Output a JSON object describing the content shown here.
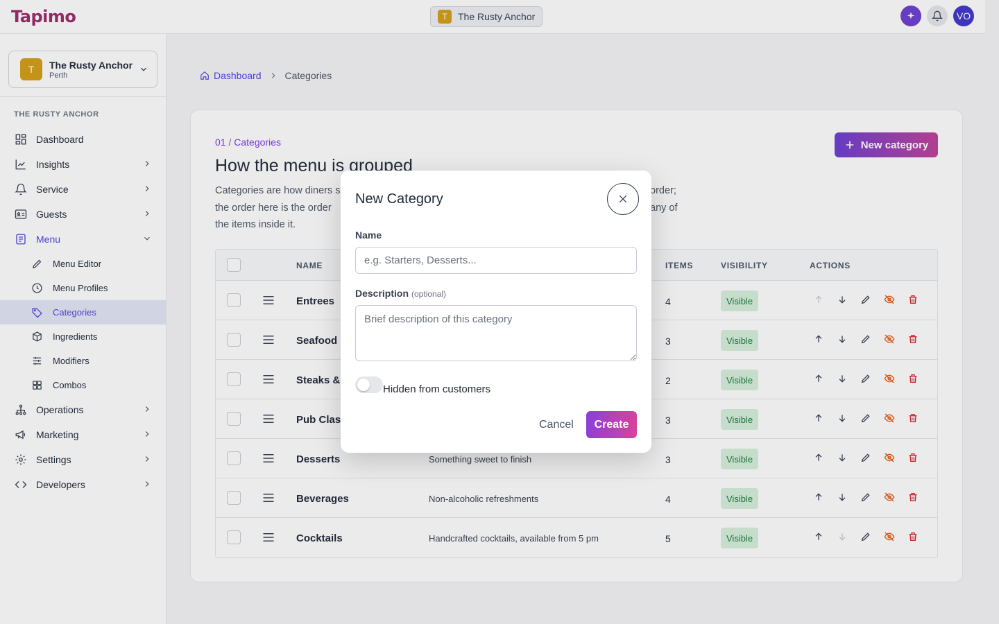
{
  "app": {
    "logo": "Tapimo",
    "venue_pill": {
      "initial": "T",
      "name": "The Rusty Anchor"
    },
    "avatar_initials": "VO"
  },
  "sidebar": {
    "venue": {
      "initial": "T",
      "name": "The Rusty Anchor",
      "city": "Perth"
    },
    "section": "THE RUSTY ANCHOR",
    "items": [
      {
        "label": "Dashboard",
        "icon": "dashboard-grid-icon",
        "chevron": false
      },
      {
        "label": "Insights",
        "icon": "chart-line-icon",
        "chevron": true
      },
      {
        "label": "Service",
        "icon": "bell-icon",
        "chevron": true
      },
      {
        "label": "Guests",
        "icon": "id-card-icon",
        "chevron": true
      },
      {
        "label": "Menu",
        "icon": "menu-doc-icon",
        "chevron": true,
        "expanded": true
      }
    ],
    "menu_sub": [
      {
        "label": "Menu Editor",
        "icon": "pencil-icon"
      },
      {
        "label": "Menu Profiles",
        "icon": "clock-icon"
      },
      {
        "label": "Categories",
        "icon": "tag-icon",
        "active": true
      },
      {
        "label": "Ingredients",
        "icon": "box-icon"
      },
      {
        "label": "Modifiers",
        "icon": "sliders-icon"
      },
      {
        "label": "Combos",
        "icon": "grid-icon"
      }
    ],
    "items_after": [
      {
        "label": "Operations",
        "icon": "sitemap-icon"
      },
      {
        "label": "Marketing",
        "icon": "megaphone-icon"
      },
      {
        "label": "Settings",
        "icon": "gear-icon"
      },
      {
        "label": "Developers",
        "icon": "code-icon"
      }
    ]
  },
  "breadcrumb": {
    "home": "Dashboard",
    "current": "Categories"
  },
  "page": {
    "step_num": "01",
    "step_label": "Categories",
    "title": "How the menu is grouped",
    "desc_line1": "Categories are how diners s",
    "desc_line1_end": "order;",
    "desc_line2": "the order here is the order",
    "desc_line2_end": "any of",
    "desc_line3": "the items inside it.",
    "new_button": "New category"
  },
  "table": {
    "headers": {
      "name": "NAME",
      "items": "ITEMS",
      "visibility": "VISIBILITY",
      "actions": "ACTIONS"
    },
    "rows": [
      {
        "name": "Entrees",
        "desc": "",
        "items": "4",
        "visibility": "Visible",
        "up_disabled": true,
        "down_disabled": false
      },
      {
        "name": "Seafood",
        "desc": "",
        "items": "3",
        "visibility": "Visible",
        "up_disabled": false,
        "down_disabled": false
      },
      {
        "name": "Steaks & I",
        "desc": "",
        "items": "2",
        "visibility": "Visible",
        "up_disabled": false,
        "down_disabled": false
      },
      {
        "name": "Pub Class",
        "desc": "",
        "items": "3",
        "visibility": "Visible",
        "up_disabled": false,
        "down_disabled": false
      },
      {
        "name": "Desserts",
        "desc": "Something sweet to finish",
        "items": "3",
        "visibility": "Visible",
        "up_disabled": false,
        "down_disabled": false
      },
      {
        "name": "Beverages",
        "desc": "Non-alcoholic refreshments",
        "items": "4",
        "visibility": "Visible",
        "up_disabled": false,
        "down_disabled": false
      },
      {
        "name": "Cocktails",
        "desc": "Handcrafted cocktails, available from 5 pm",
        "items": "5",
        "visibility": "Visible",
        "up_disabled": false,
        "down_disabled": true
      }
    ]
  },
  "modal": {
    "title": "New Category",
    "name_label": "Name",
    "name_placeholder": "e.g. Starters, Desserts...",
    "name_value": "",
    "desc_label": "Description",
    "desc_optional": "(optional)",
    "desc_placeholder": "Brief description of this category",
    "desc_value": "",
    "toggle_label": "Hidden from customers",
    "toggle_on": false,
    "cancel": "Cancel",
    "create": "Create"
  },
  "colors": {
    "accent": "#4f46e5",
    "brand": "#9b2c6a",
    "gradient_start": "#6d3fd0",
    "gradient_end": "#c0439a",
    "visible_badge_bg": "#d7f0dc",
    "visible_badge_text": "#1a7a3a",
    "hide_icon": "#ea580c",
    "delete_icon": "#dc2626"
  }
}
